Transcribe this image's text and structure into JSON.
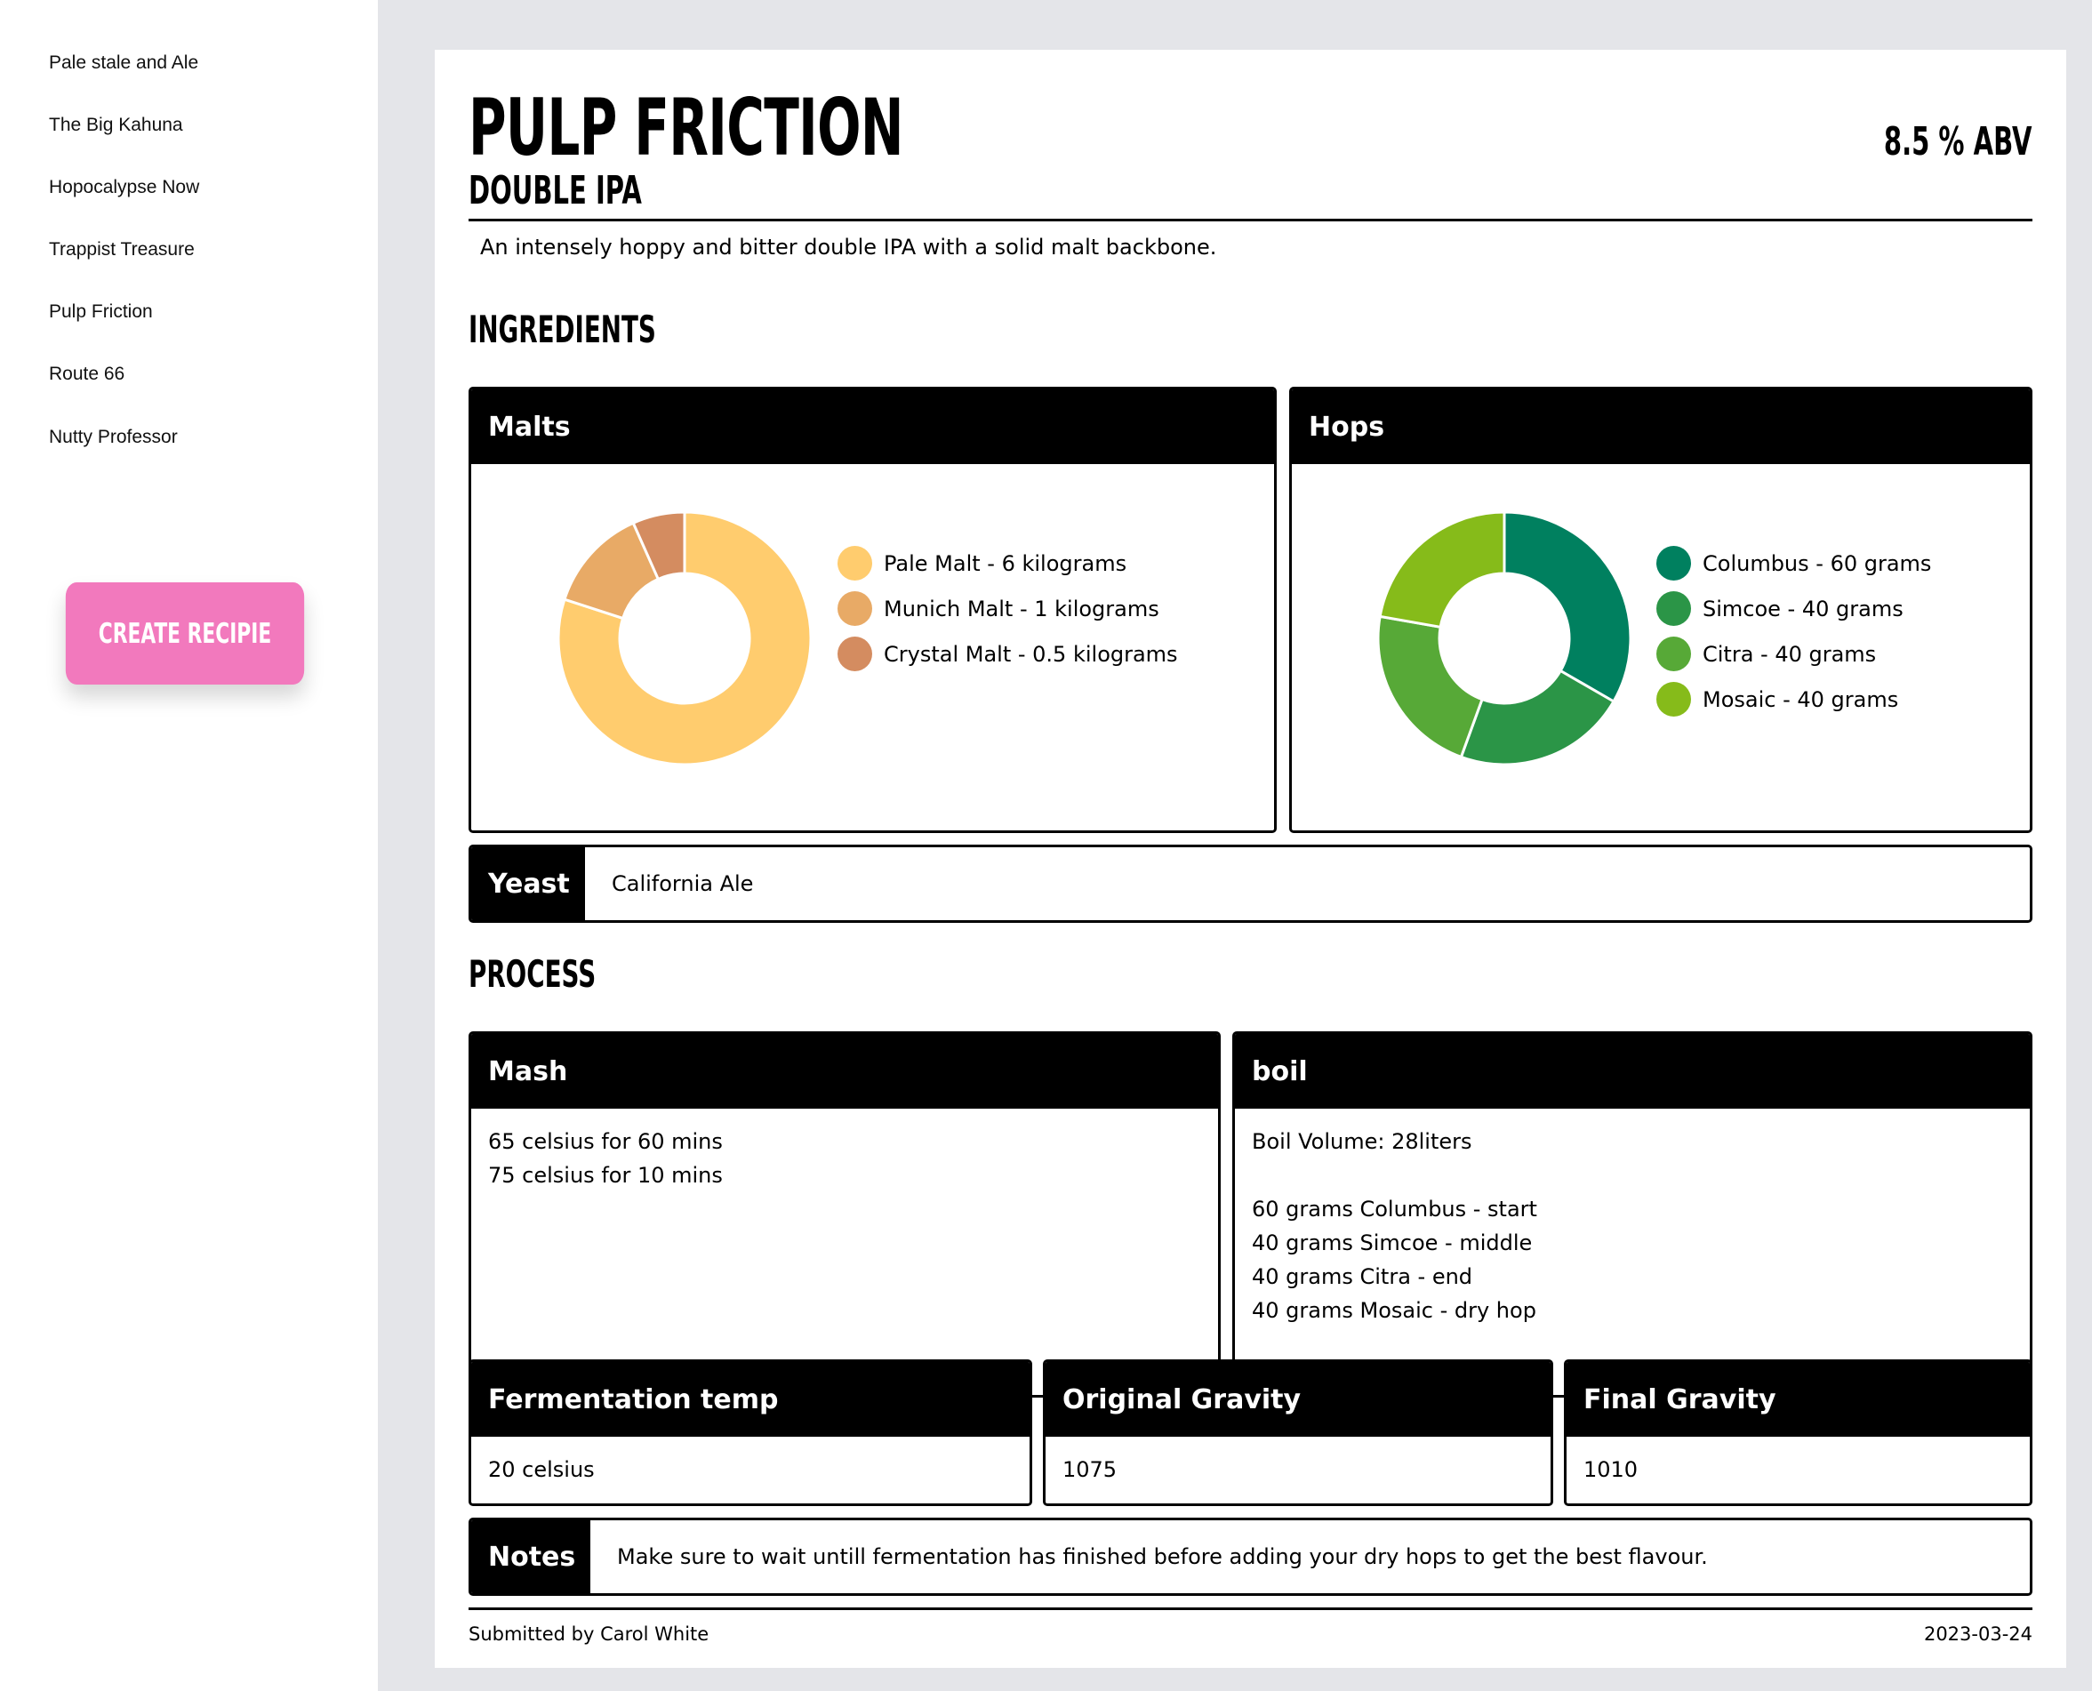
{
  "sidebar": {
    "items": [
      {
        "label": "Pale stale and Ale"
      },
      {
        "label": "The Big Kahuna"
      },
      {
        "label": "Hopocalypse Now"
      },
      {
        "label": "Trappist Treasure"
      },
      {
        "label": "Pulp Friction"
      },
      {
        "label": "Route 66"
      },
      {
        "label": "Nutty Professor"
      }
    ],
    "create_button": "CREATE RECIPIE"
  },
  "recipe": {
    "name": "PULP FRICTION",
    "abv": "8.5 % ABV",
    "style": "DOUBLE IPA",
    "description": "An intensely hoppy and bitter double IPA with a solid malt backbone.",
    "ingredients_heading": "INGREDIENTS",
    "process_heading": "PROCESS",
    "malts": {
      "title": "Malts",
      "items": [
        {
          "label": "Pale Malt - 6 kilograms",
          "value": 6,
          "color": "#ffcc6e"
        },
        {
          "label": "Munich Malt - 1 kilograms",
          "value": 1,
          "color": "#e8aa66"
        },
        {
          "label": "Crystal Malt - 0.5 kilograms",
          "value": 0.5,
          "color": "#d48c60"
        }
      ]
    },
    "hops": {
      "title": "Hops",
      "items": [
        {
          "label": "Columbus - 60 grams",
          "value": 60,
          "color": "#00805f"
        },
        {
          "label": "Simcoe - 40 grams",
          "value": 40,
          "color": "#2b9547"
        },
        {
          "label": "Citra - 40 grams",
          "value": 40,
          "color": "#57a937"
        },
        {
          "label": "Mosaic - 40 grams",
          "value": 40,
          "color": "#86bb1a"
        }
      ]
    },
    "yeast": {
      "label": "Yeast",
      "value": "California Ale"
    },
    "mash": {
      "title": "Mash",
      "lines": [
        "65 celsius for 60 mins",
        "75 celsius for 10 mins"
      ]
    },
    "boil": {
      "title": "boil",
      "volume": "Boil Volume: 28liters",
      "lines": [
        "60 grams Columbus - start",
        "40 grams Simcoe - middle",
        "40 grams Citra - end",
        "40 grams Mosaic - dry hop"
      ]
    },
    "fermentation": {
      "title": "Fermentation temp",
      "value": "20 celsius"
    },
    "og": {
      "title": "Original Gravity",
      "value": "1075"
    },
    "fg": {
      "title": "Final Gravity",
      "value": "1010"
    },
    "notes": {
      "label": "Notes",
      "value": "Make sure to wait untill fermentation has finished before adding your dry hops to get the best flavour."
    },
    "submitted_by": "Submitted by Carol White",
    "date": "2023-03-24"
  },
  "chart_data": [
    {
      "type": "pie",
      "categories": [
        "Pale Malt - 6 kilograms",
        "Munich Malt - 1 kilograms",
        "Crystal Malt - 0.5 kilograms"
      ],
      "values": [
        6,
        1,
        0.5
      ]
    },
    {
      "type": "pie",
      "categories": [
        "Columbus - 60 grams",
        "Simcoe - 40 grams",
        "Citra - 40 grams",
        "Mosaic - 40 grams"
      ],
      "values": [
        60,
        40,
        40,
        40
      ]
    }
  ]
}
